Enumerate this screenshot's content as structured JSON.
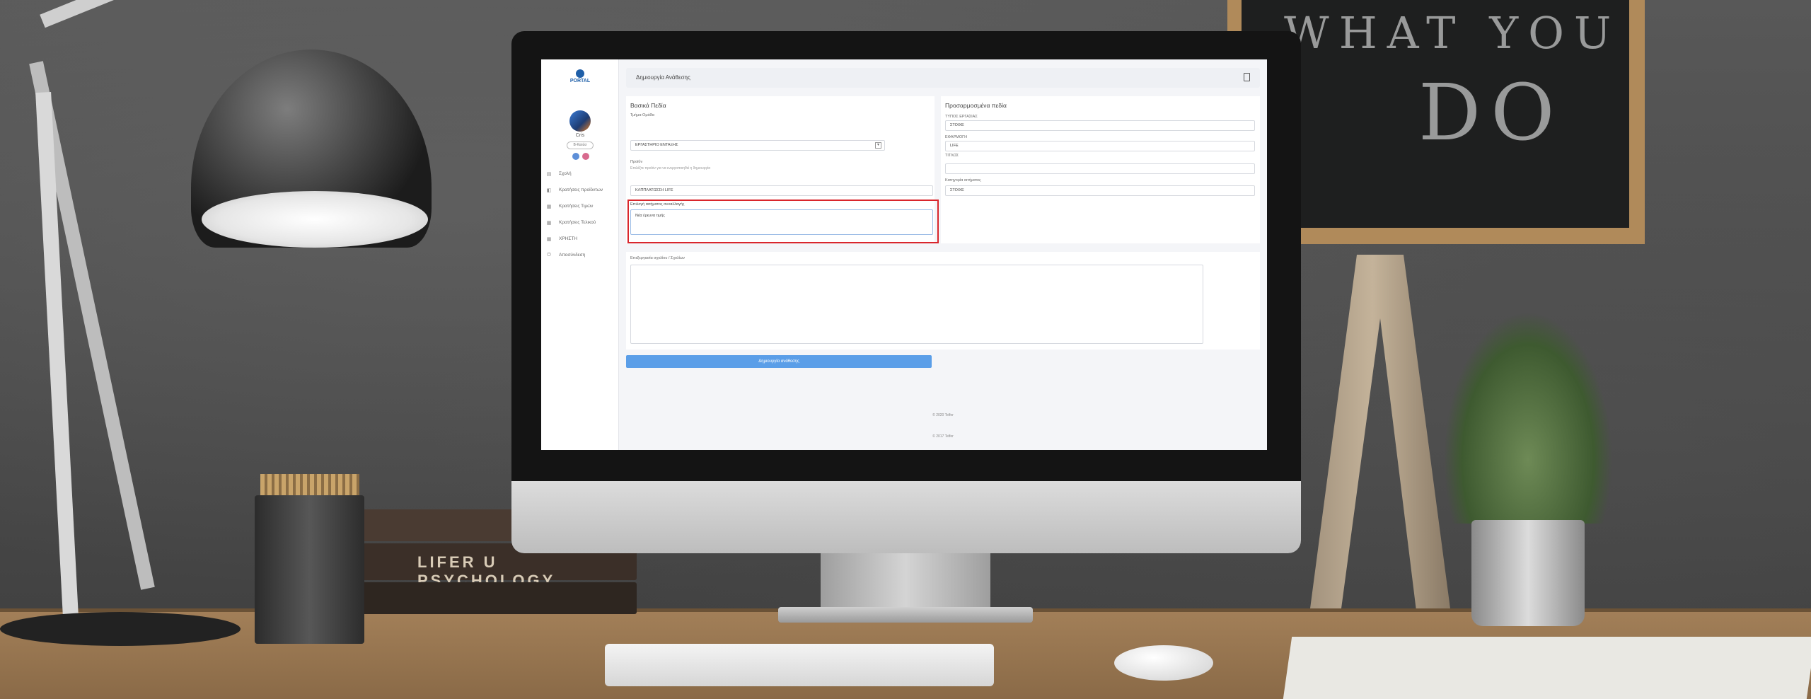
{
  "scene": {
    "chalkboard_text_1": "WHAT YOU",
    "chalkboard_text_2": "DO",
    "book_label": "LIFER U  PSYCHOLOGY"
  },
  "app": {
    "logo_text": "PORTAL",
    "user": {
      "name": "Cris",
      "badge": "Β-Κατάσ"
    },
    "nav": [
      {
        "icon": "▤",
        "label": "Σχολή"
      },
      {
        "icon": "◧",
        "label": "Κρατήσεις προϊόντων"
      },
      {
        "icon": "▦",
        "label": "Κρατήσεις Τιμών"
      },
      {
        "icon": "▦",
        "label": "Κρατήσεις Τελικού"
      },
      {
        "icon": "▦",
        "label": "ΧΡΗΣΤΗ"
      },
      {
        "icon": "⏻",
        "label": "Αποσύνδεση"
      }
    ],
    "page_title": "Δημιουργία Ανάθεσης",
    "basic": {
      "title": "Βασικά Πεδία",
      "section_label": "Τμήμα Ομάδα",
      "dept_value": "ΕΡΓΑΣΤΗΡΙΟ ΕΝΤΑΞΗΣ",
      "proion_label": "Προϊόν",
      "proion_hint": "Επιλέξτε προϊόν για να ενεργοποιηθεί η δημιουργία",
      "proion_value": "ΚΛΠΠΛΑΤΩΣΣΗ LIFE",
      "request_label": "Επιλογή αιτήματος συναλλαγής",
      "request_value": "Νέα έρευνα τιμής"
    },
    "custom": {
      "title": "Προσαρμοσμένα πεδία",
      "fields": [
        {
          "label": "ΤΥΠΟΣ ΕΡΓΑΣΙΑΣ",
          "value": "ΣΤΟΙΧΕ"
        },
        {
          "label": "ΕΦΑΡΜΟΓΗ",
          "value": "LIFE"
        },
        {
          "label": "ΤΙΤΛΟΣ",
          "value": ""
        },
        {
          "label": "Κατηγορία αιτήματος",
          "value": "ΣΤΟΙΧΕ"
        }
      ]
    },
    "comments_label": "Επεξεργασία σχολίου / Σχολίων",
    "submit_label": "Δημιουργία ανάθεσης",
    "footer_1": "© 2020 Telfer",
    "footer_2": "© 2017 Telfer"
  }
}
